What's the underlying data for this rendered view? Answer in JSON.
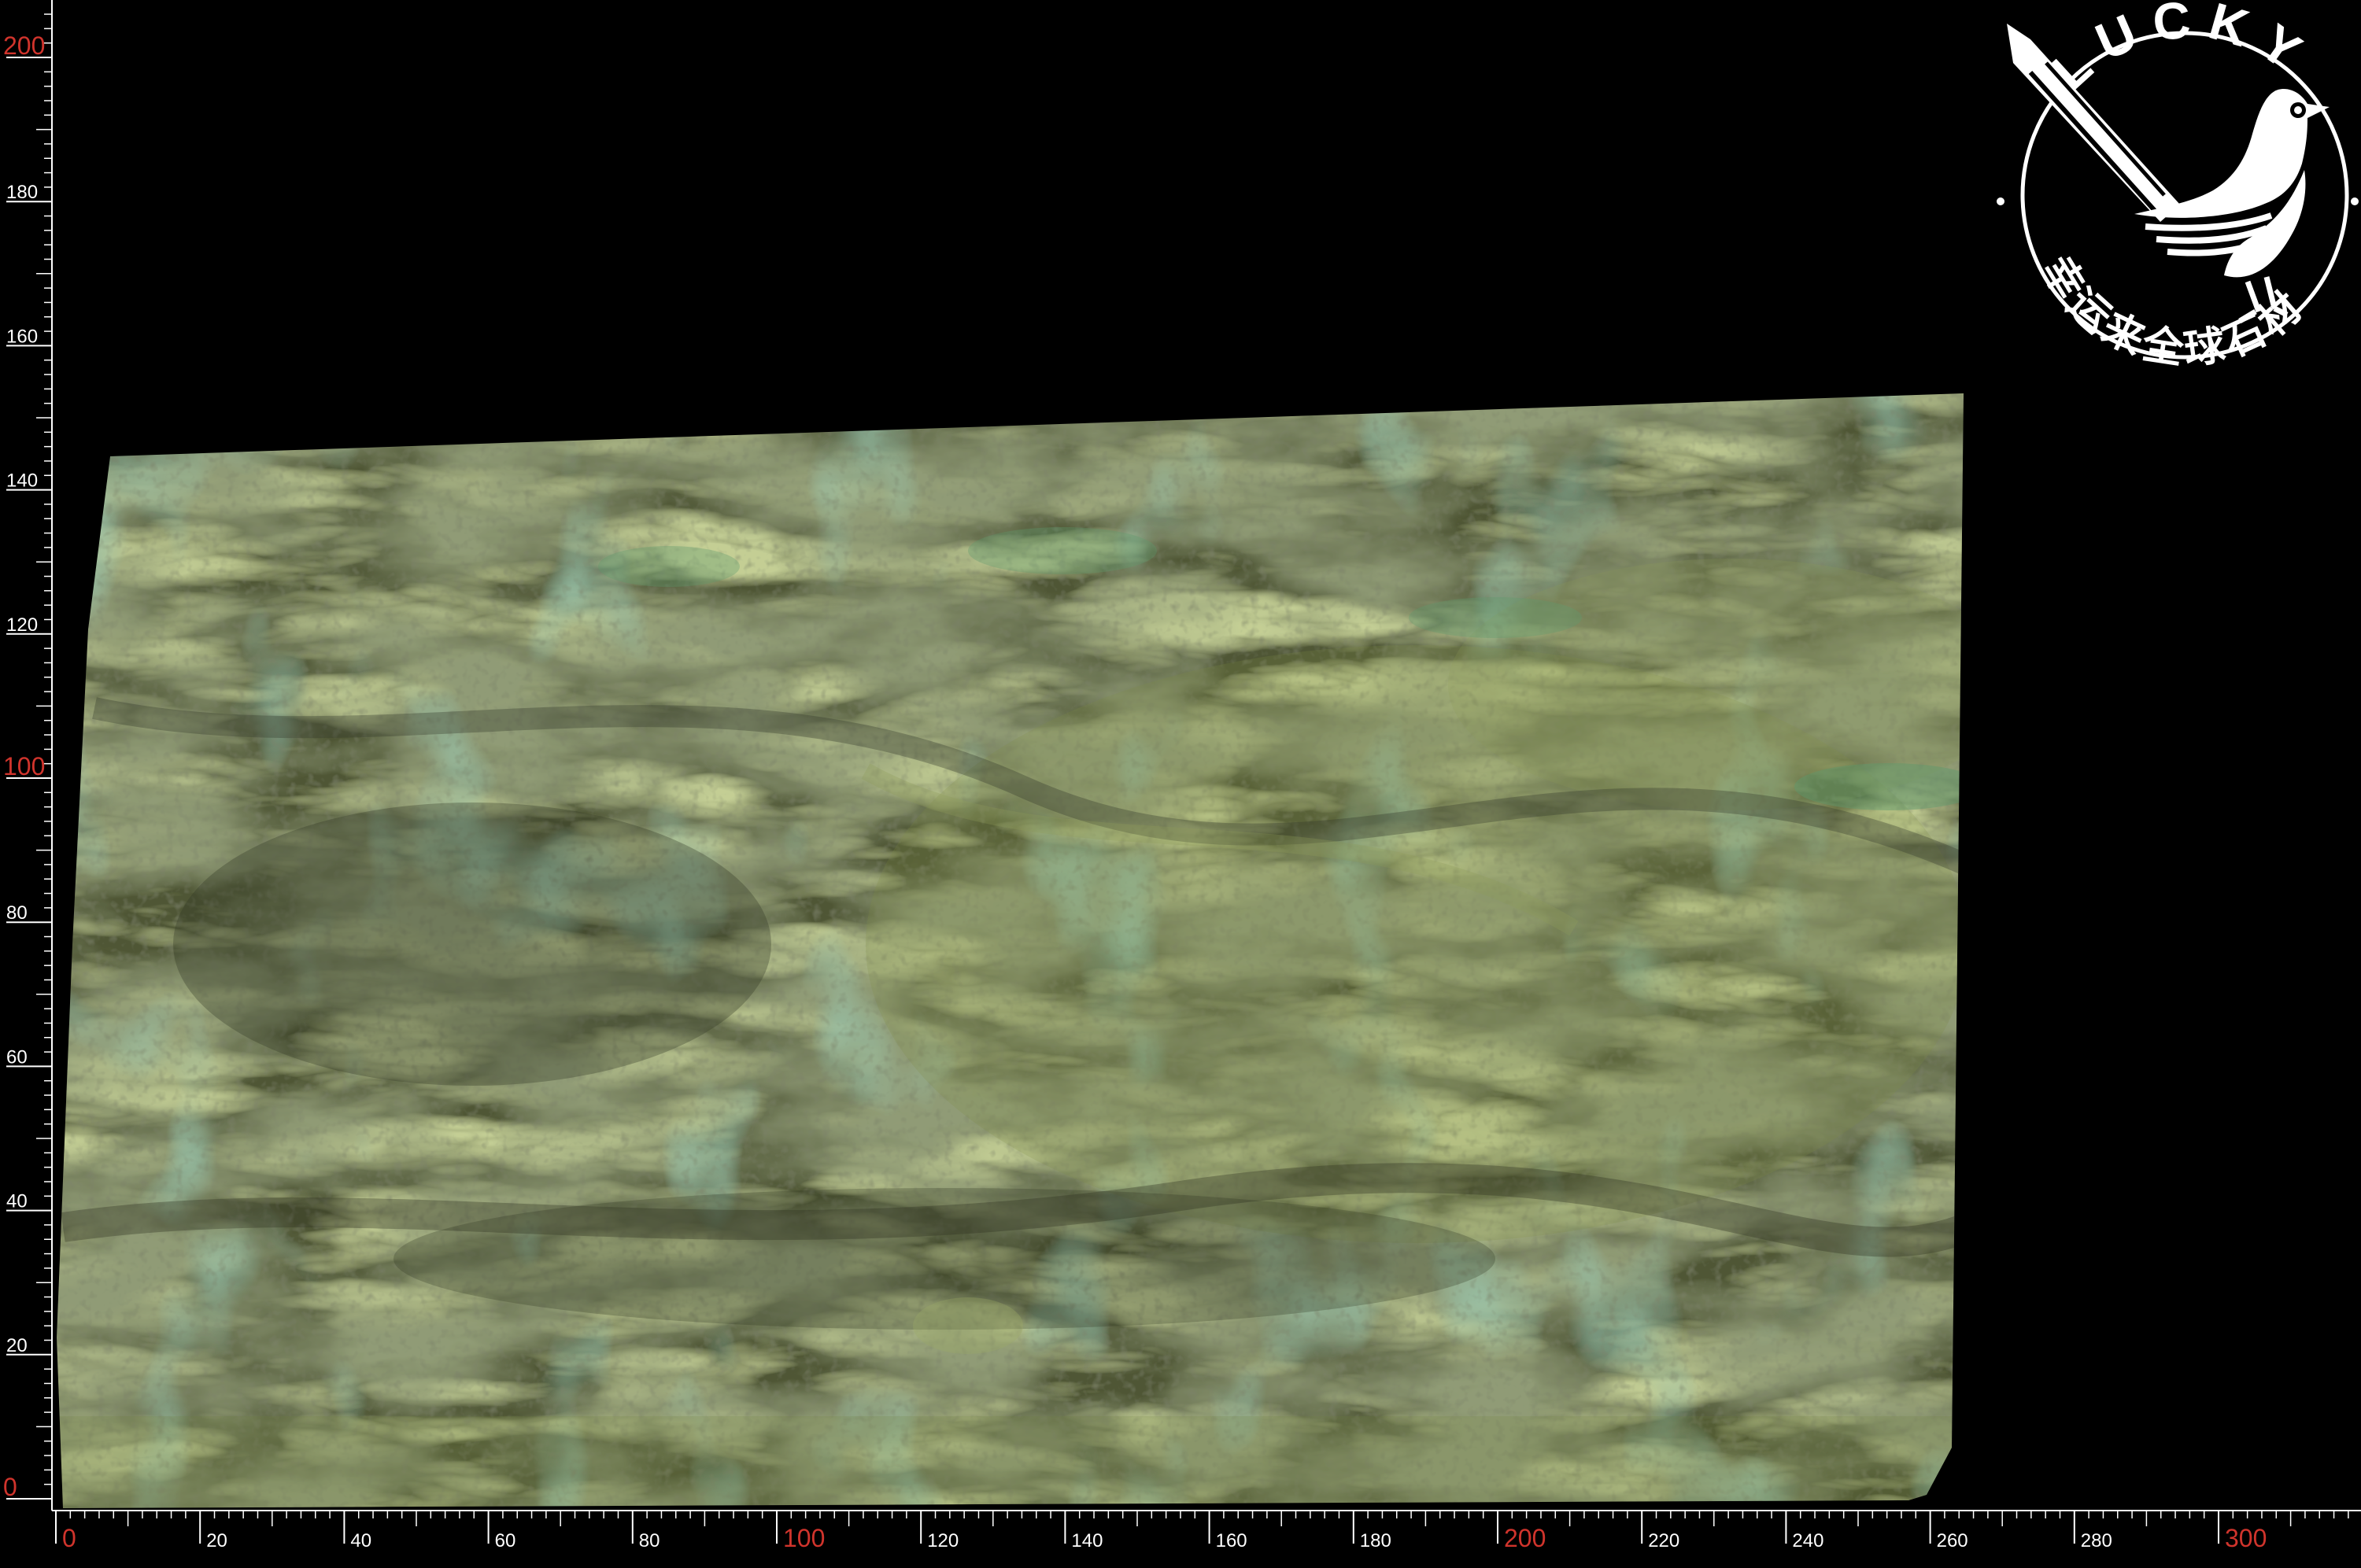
{
  "scene": {
    "subject": "green marble slab",
    "background_color": "#000000",
    "slab_base_color": "#4f5636",
    "vein_colors": [
      "#6b7a3c",
      "#3b4128",
      "#5c8a63",
      "#8a9a55",
      "#2e3320"
    ]
  },
  "ruler": {
    "unit": "cm",
    "x_ticks": [
      "0",
      "20",
      "40",
      "60",
      "80",
      "100",
      "120",
      "140",
      "160",
      "180",
      "200",
      "220",
      "240",
      "260",
      "280",
      "300"
    ],
    "x_red_ticks": [
      "0",
      "100",
      "200",
      "300"
    ],
    "y_ticks": [
      "0",
      "20",
      "40",
      "60",
      "80",
      "100",
      "120",
      "140",
      "160",
      "180",
      "200"
    ],
    "y_red_ticks": [
      "0",
      "100",
      "200"
    ],
    "x_max": 320,
    "y_max": 207,
    "label_color": "#ffffff",
    "accent_color": "#d0342c"
  },
  "logo": {
    "wordmark": "LUCKY",
    "tagline": "幸运来全球石材",
    "color": "#ffffff",
    "icon": "magpie-bird-icon"
  }
}
